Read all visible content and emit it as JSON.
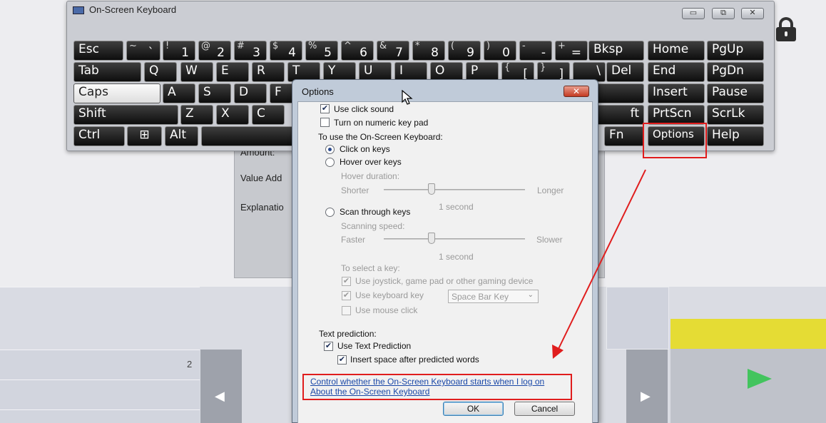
{
  "keyboard_window": {
    "title": "On-Screen Keyboard",
    "controls": {
      "minimize": "▭",
      "restore": "⧉",
      "close": "✕"
    },
    "keys": {
      "esc": "Esc",
      "tilde": {
        "sub": "~",
        "main": "`"
      },
      "n1": {
        "sub": "!",
        "main": "1"
      },
      "n2": {
        "sub": "@",
        "main": "2"
      },
      "n3": {
        "sub": "#",
        "main": "3"
      },
      "n4": {
        "sub": "$",
        "main": "4"
      },
      "n5": {
        "sub": "%",
        "main": "5"
      },
      "n6": {
        "sub": "^",
        "main": "6"
      },
      "n7": {
        "sub": "&",
        "main": "7"
      },
      "n8": {
        "sub": "*",
        "main": "8"
      },
      "n9": {
        "sub": "(",
        "main": "9"
      },
      "n0": {
        "sub": ")",
        "main": "0"
      },
      "minus": {
        "sub": "-",
        "main": "-"
      },
      "equals": {
        "sub": "+",
        "main": "="
      },
      "bksp": "Bksp",
      "home": "Home",
      "pgup": "PgUp",
      "tab": "Tab",
      "q": "Q",
      "w": "W",
      "e": "E",
      "r": "R",
      "t": "T",
      "y": "Y",
      "u": "U",
      "i": "I",
      "o": "O",
      "p": "P",
      "lbracket": {
        "sub": "{",
        "main": "["
      },
      "rbracket": {
        "sub": "}",
        "main": "]"
      },
      "backslash": "\\",
      "del": "Del",
      "end": "End",
      "pgdn": "PgDn",
      "caps": "Caps",
      "a": "A",
      "s": "S",
      "d": "D",
      "f": "F",
      "insert": "Insert",
      "pause": "Pause",
      "shift": "Shift",
      "z": "Z",
      "x": "X",
      "c": "C",
      "shift_right_partial": "ft",
      "prtscn": "PrtScn",
      "scrlk": "ScrLk",
      "ctrl": "Ctrl",
      "win": "⊞",
      "alt": "Alt",
      "fn": "Fn",
      "options": "Options",
      "help": "Help"
    }
  },
  "background_form": {
    "amount_label": "Amount:",
    "value_add_label": "Value Add",
    "explanation_label": "Explanatio",
    "row_number": "2"
  },
  "options_dialog": {
    "title": "Options",
    "close_glyph": "✕",
    "use_click_sound": {
      "label": "Use click sound",
      "checked": true
    },
    "numeric_key_pad": {
      "label": "Turn on numeric key pad",
      "checked": false
    },
    "use_osk_heading": "To use the On-Screen Keyboard:",
    "click_on_keys": {
      "label": "Click on keys",
      "selected": true
    },
    "hover_over_keys": {
      "label": "Hover over keys",
      "selected": false
    },
    "hover_duration": {
      "label": "Hover duration:",
      "min_label": "Shorter",
      "max_label": "Longer",
      "value_label": "1 second"
    },
    "scan_through_keys": {
      "label": "Scan through keys",
      "selected": false
    },
    "scanning_speed": {
      "label": "Scanning speed:",
      "min_label": "Faster",
      "max_label": "Slower",
      "value_label": "1 second"
    },
    "select_key_heading": "To select a key:",
    "use_joystick": {
      "label": "Use joystick, game pad or other gaming device",
      "checked": true
    },
    "use_keyboard_key": {
      "label": "Use keyboard key",
      "checked": true
    },
    "keyboard_key_select": {
      "value": "Space Bar Key"
    },
    "use_mouse_click": {
      "label": "Use mouse click",
      "checked": false
    },
    "text_prediction_heading": "Text prediction:",
    "use_text_prediction": {
      "label": "Use Text Prediction",
      "checked": true
    },
    "insert_space": {
      "label": "Insert space after predicted words",
      "checked": true
    },
    "link_logon": "Control whether the On-Screen Keyboard starts when I log on",
    "link_about": "About the On-Screen Keyboard",
    "ok_label": "OK",
    "cancel_label": "Cancel"
  },
  "colors": {
    "annotation_red": "#e01d1d",
    "link_blue": "#1b49a8",
    "key_black": "#111111",
    "accent_yellow": "#e5dc34",
    "play_green": "#43c45e"
  }
}
